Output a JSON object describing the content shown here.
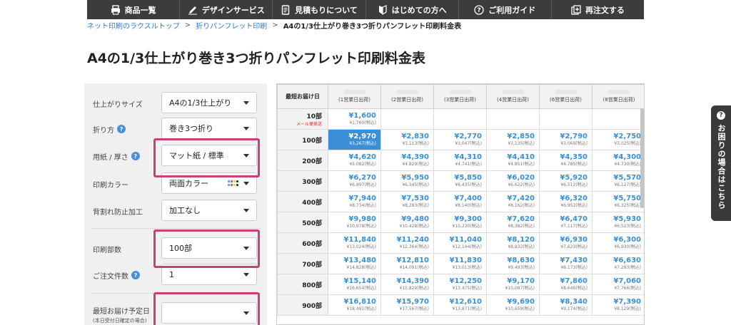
{
  "nav": {
    "items": [
      {
        "label": "商品一覧",
        "icon": "printer-icon"
      },
      {
        "label": "デザインサービス",
        "icon": "pen-icon"
      },
      {
        "label": "見積もりについて",
        "icon": "document-icon"
      },
      {
        "label": "はじめての方へ",
        "icon": "beginner-mark-icon"
      },
      {
        "label": "ご利用ガイド",
        "icon": "question-circle-icon"
      },
      {
        "label": "再注文する",
        "icon": "reorder-icon"
      }
    ]
  },
  "breadcrumb": {
    "home": "ネット印刷のラクスルトップ",
    "category": "折りパンフレット印刷",
    "current": "A4の1/3仕上がり巻き3つ折りパンフレット印刷料金表",
    "separator": ">"
  },
  "page_title": "A4の1/3仕上がり巻き3つ折りパンフレット印刷料金表",
  "options": {
    "size": {
      "label": "仕上がりサイズ",
      "value": "A4の1/3仕上がり"
    },
    "fold": {
      "label": "折り方",
      "value": "巻き3つ折り"
    },
    "paper": {
      "label": "用紙 / 厚さ",
      "value": "マット紙 / 標準"
    },
    "color": {
      "label": "印刷カラー",
      "value": "両面カラー"
    },
    "finish": {
      "label": "背割れ防止加工",
      "value": "加工なし"
    },
    "quantity": {
      "label": "印刷部数",
      "value": "100部"
    },
    "files": {
      "label": "ご注文件数",
      "value": "1"
    },
    "delivery": {
      "label": "最短お届け予定日",
      "sublabel": "(本日受付日確定の場合)",
      "value": ""
    }
  },
  "table": {
    "corner": "最短お届け日",
    "headers": [
      "(1営業日出荷)",
      "(2営業日出荷)",
      "(3営業日出荷)",
      "(4営業日出荷)",
      "(6営業日出荷)",
      "(8営業日出荷)"
    ],
    "rows": [
      {
        "qty": "10部",
        "note": "メール便発送",
        "cells": [
          {
            "price": "¥1,600",
            "tax": "¥1,760(税込)"
          },
          null,
          null,
          null,
          null,
          null
        ]
      },
      {
        "qty": "100部",
        "cells": [
          {
            "price": "¥2,970",
            "tax": "¥3,267(税込)"
          },
          {
            "price": "¥2,830",
            "tax": "¥3,113(税込)"
          },
          {
            "price": "¥2,770",
            "tax": "¥3,047(税込)"
          },
          {
            "price": "¥2,850",
            "tax": "¥3,135(税込)"
          },
          {
            "price": "¥2,790",
            "tax": "¥3,069(税込)"
          },
          {
            "price": "¥2,750",
            "tax": "¥3,025(税込)"
          }
        ]
      },
      {
        "qty": "200部",
        "cells": [
          {
            "price": "¥4,620",
            "tax": "¥5,082(税込)"
          },
          {
            "price": "¥4,390",
            "tax": "¥4,829(税込)"
          },
          {
            "price": "¥4,310",
            "tax": "¥4,741(税込)"
          },
          {
            "price": "¥4,410",
            "tax": "¥4,851(税込)"
          },
          {
            "price": "¥4,350",
            "tax": "¥4,785(税込)"
          },
          {
            "price": "¥4,300",
            "tax": "¥4,730(税込)"
          }
        ]
      },
      {
        "qty": "300部",
        "cells": [
          {
            "price": "¥6,270",
            "tax": "¥6,897(税込)"
          },
          {
            "price": "¥5,950",
            "tax": "¥6,545(税込)"
          },
          {
            "price": "¥5,850",
            "tax": "¥6,435(税込)"
          },
          {
            "price": "¥6,020",
            "tax": "¥6,622(税込)"
          },
          {
            "price": "¥5,920",
            "tax": "¥6,512(税込)"
          },
          {
            "price": "¥5,570",
            "tax": "¥6,127(税込)"
          }
        ]
      },
      {
        "qty": "400部",
        "cells": [
          {
            "price": "¥7,940",
            "tax": "¥8,734(税込)"
          },
          {
            "price": "¥7,530",
            "tax": "¥8,283(税込)"
          },
          {
            "price": "¥7,400",
            "tax": "¥8,140(税込)"
          },
          {
            "price": "¥7,420",
            "tax": "¥8,162(税込)"
          },
          {
            "price": "¥6,320",
            "tax": "¥6,952(税込)"
          },
          {
            "price": "¥5,750",
            "tax": "¥6,325(税込)"
          }
        ]
      },
      {
        "qty": "500部",
        "cells": [
          {
            "price": "¥9,980",
            "tax": "¥10,978(税込)"
          },
          {
            "price": "¥9,480",
            "tax": "¥10,428(税込)"
          },
          {
            "price": "¥9,300",
            "tax": "¥10,230(税込)"
          },
          {
            "price": "¥7,620",
            "tax": "¥8,382(税込)"
          },
          {
            "price": "¥6,470",
            "tax": "¥7,117(税込)"
          },
          {
            "price": "¥5,930",
            "tax": "¥6,523(税込)"
          }
        ]
      },
      {
        "qty": "600部",
        "cells": [
          {
            "price": "¥11,840",
            "tax": "¥13,024(税込)"
          },
          {
            "price": "¥11,240",
            "tax": "¥12,364(税込)"
          },
          {
            "price": "¥11,040",
            "tax": "¥12,144(税込)"
          },
          {
            "price": "¥8,120",
            "tax": "¥8,932(税込)"
          },
          {
            "price": "¥6,930",
            "tax": "¥7,623(税込)"
          },
          {
            "price": "¥6,300",
            "tax": "¥6,930(税込)"
          }
        ]
      },
      {
        "qty": "700部",
        "cells": [
          {
            "price": "¥13,480",
            "tax": "¥14,828(税込)"
          },
          {
            "price": "¥12,810",
            "tax": "¥14,091(税込)"
          },
          {
            "price": "¥11,830",
            "tax": "¥13,013(税込)"
          },
          {
            "price": "¥8,630",
            "tax": "¥9,493(税込)"
          },
          {
            "price": "¥7,430",
            "tax": "¥8,173(税込)"
          },
          {
            "price": "¥6,630",
            "tax": "¥7,293(税込)"
          }
        ]
      },
      {
        "qty": "800部",
        "cells": [
          {
            "price": "¥15,140",
            "tax": "¥16,654(税込)"
          },
          {
            "price": "¥14,390",
            "tax": "¥15,829(税込)"
          },
          {
            "price": "¥12,250",
            "tax": "¥13,475(税込)"
          },
          {
            "price": "¥9,170",
            "tax": "¥10,087(税込)"
          },
          {
            "price": "¥7,860",
            "tax": "¥8,646(税込)"
          },
          {
            "price": "¥7,060",
            "tax": "¥7,766(税込)"
          }
        ]
      },
      {
        "qty": "900部",
        "cells": [
          {
            "price": "¥16,810",
            "tax": "¥18,491(税込)"
          },
          {
            "price": "¥15,970",
            "tax": "¥17,567(税込)"
          },
          {
            "price": "¥12,610",
            "tax": "¥13,871(税込)"
          },
          {
            "price": "¥9,690",
            "tax": "¥10,659(税込)"
          },
          {
            "price": "¥8,340",
            "tax": "¥9,174(税込)"
          },
          {
            "price": "¥7,390",
            "tax": "¥8,129(税込)"
          }
        ]
      }
    ]
  },
  "help_tab": {
    "label": "お困りの場合はこちら",
    "icon_char": "?"
  },
  "help_icon_char": "?",
  "colors": {
    "accent": "#3a8fd6",
    "highlight": "#c8407a",
    "nav_bg": "#3c3c3c"
  }
}
